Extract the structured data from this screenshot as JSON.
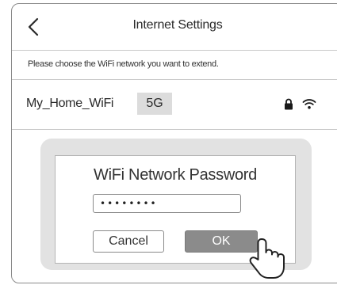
{
  "header": {
    "back_icon": "chevron-left-icon",
    "title": "Internet Settings"
  },
  "instruction": "Please choose the WiFi network you want to extend.",
  "network": {
    "name": "My_Home_WiFi",
    "band": "5G",
    "lock_icon": "lock-icon",
    "signal_icon": "wifi-icon"
  },
  "dialog": {
    "title": "WiFi Network Password",
    "password_value": "••••••••",
    "cancel_label": "Cancel",
    "ok_label": "OK",
    "pointer_icon": "hand-pointer-icon"
  },
  "colors": {
    "frame_border": "#8a8a8a",
    "divider": "#c8c8c8",
    "backdrop": "#e2e2e2",
    "ok_button": "#8b8b8b",
    "badge": "#dcdcdc"
  }
}
